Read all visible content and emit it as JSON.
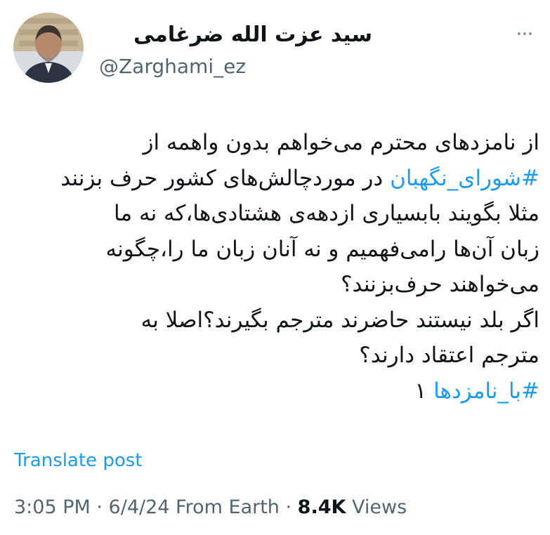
{
  "author": {
    "display_name": "سید عزت الله ضرغامی",
    "handle": "@Zarghami_ez",
    "avatar_icon": "avatar-photo"
  },
  "tweet": {
    "lines": [
      [
        {
          "text": "از نامزدهای محترم می‌خواهم بدون واهمه از"
        }
      ],
      [
        {
          "text": "#شورای_نگهبان",
          "hashtag": true
        },
        {
          "text": " در موردچالش‌های کشور حرف بزنند"
        }
      ],
      [
        {
          "text": "مثلا بگویند بابسیاری ازدهه‌ی هشتادی‌ها،که نه ما"
        }
      ],
      [
        {
          "text": "زبان آن‌ها رامی‌فهمیم و نه آنان زبان ما را،چگونه"
        }
      ],
      [
        {
          "text": "می‌خواهند حرف‌بزنند؟"
        }
      ],
      [
        {
          "text": "اگر بلد نیستند حاضرند مترجم بگیرند؟اصلا به"
        }
      ],
      [
        {
          "text": "مترجم اعتقاد دارند؟"
        }
      ],
      [
        {
          "text": "#با_نامزدها",
          "hashtag": true
        },
        {
          "text": " ۱"
        }
      ]
    ]
  },
  "translate_label": "Translate post",
  "meta": {
    "time": "3:05 PM",
    "separator": " · ",
    "date": "6/4/24",
    "source": " From Earth",
    "views_count": "8.4K",
    "views_label": " Views"
  },
  "colors": {
    "text": "#0f1419",
    "secondary": "#536471",
    "link": "#1d9bf0"
  }
}
